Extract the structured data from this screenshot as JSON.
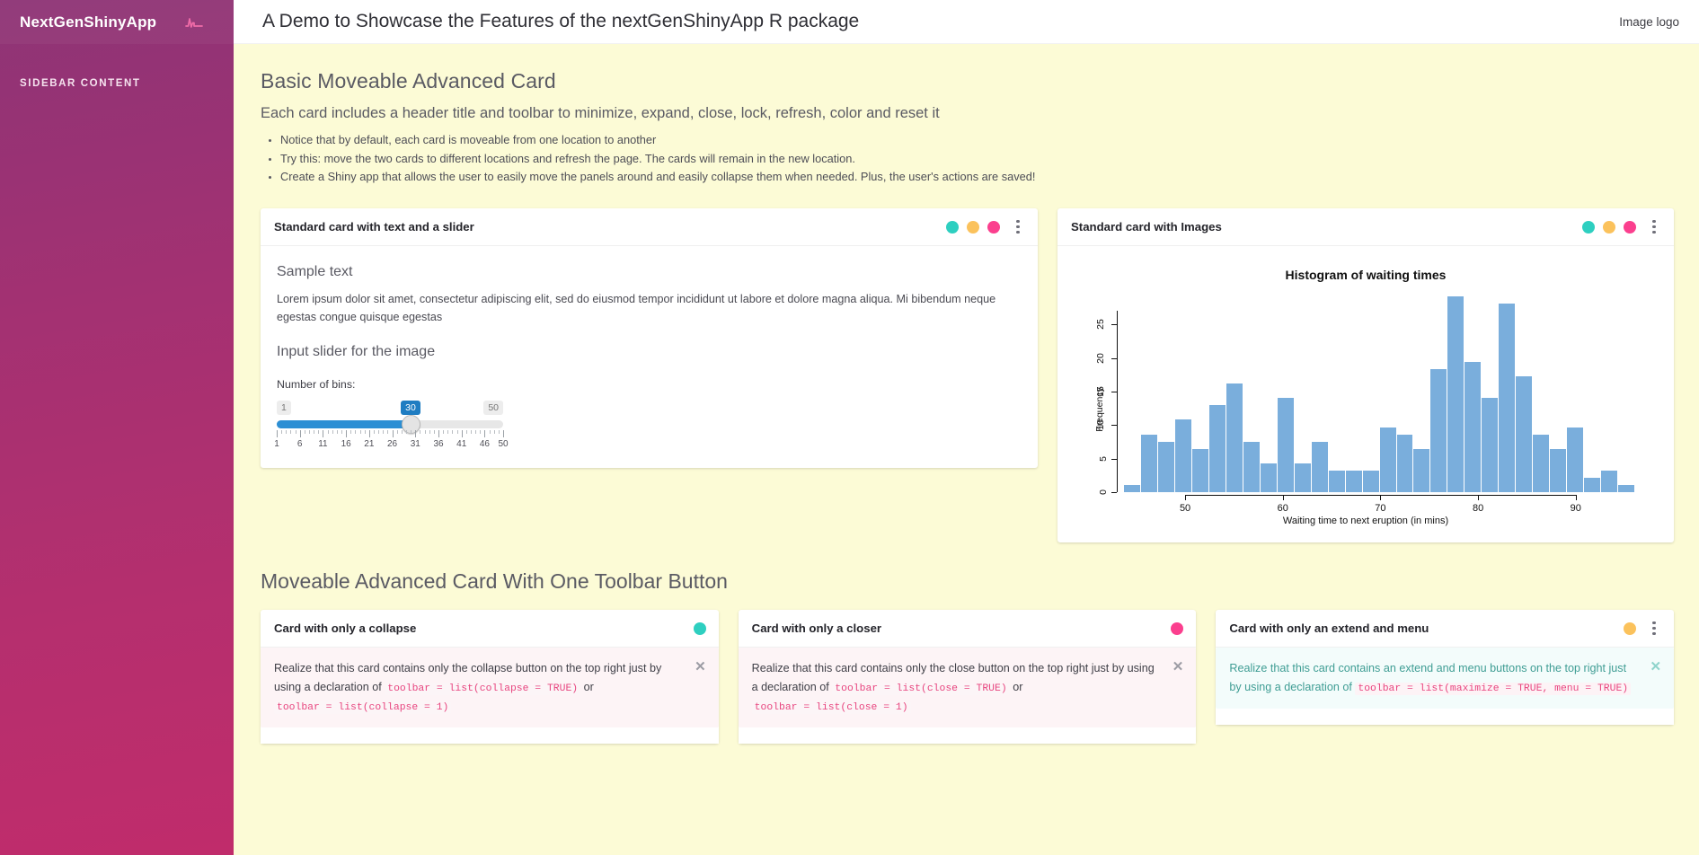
{
  "sidebar": {
    "brand": "NextGenShinyApp",
    "logo_icon": "pulse-waveform-icon",
    "heading": "SIDEBAR CONTENT",
    "gradient_from": "#8e3476",
    "gradient_to": "#c02c6b"
  },
  "topbar": {
    "title": "A Demo to Showcase the Features of the nextGenShinyApp R package",
    "right_label": "Image logo"
  },
  "section1": {
    "title": "Basic Moveable Advanced Card",
    "subtitle": "Each card includes a header title and toolbar to minimize, expand, close, lock, refresh, color and reset it",
    "bullets": [
      "Notice that by default, each card is moveable from one location to another",
      "Try this: move the two cards to different locations and refresh the page. The cards will remain in the new location.",
      "Create a Shiny app that allows the user to easily move the panels around and easily collapse them when needed. Plus, the user's actions are saved!"
    ]
  },
  "card_slider": {
    "title": "Standard card with text and a slider",
    "tools": {
      "dots": [
        {
          "name": "collapse-dot",
          "color": "#2ecfc0"
        },
        {
          "name": "maximize-dot",
          "color": "#fbc25c"
        },
        {
          "name": "close-dot",
          "color": "#fb3f8e"
        }
      ],
      "menu_icon": "kebab-menu-icon"
    },
    "sample_heading": "Sample text",
    "sample_text": "Lorem ipsum dolor sit amet, consectetur adipiscing elit, sed do eiusmod tempor incididunt ut labore et dolore magna aliqua. Mi bibendum neque egestas congue quisque egestas",
    "slider_heading": "Input slider for the image",
    "slider": {
      "label": "Number of bins:",
      "min": 1,
      "max": 50,
      "value": 30,
      "min_label": "1",
      "max_label": "50",
      "value_label": "30",
      "tick_labels": [
        "1",
        "6",
        "11",
        "16",
        "21",
        "26",
        "31",
        "36",
        "41",
        "46",
        "50"
      ],
      "tick_values": [
        1,
        6,
        11,
        16,
        21,
        26,
        31,
        36,
        41,
        46,
        50
      ],
      "fill_color": "#2c8fd4"
    }
  },
  "card_images": {
    "title": "Standard card with Images",
    "tools": {
      "dots": [
        {
          "name": "collapse-dot",
          "color": "#2ecfc0"
        },
        {
          "name": "maximize-dot",
          "color": "#fbc25c"
        },
        {
          "name": "close-dot",
          "color": "#fb3f8e"
        }
      ],
      "menu_icon": "kebab-menu-icon"
    }
  },
  "chart_data": {
    "type": "bar",
    "title": "Histogram of waiting times",
    "xlabel": "Waiting time to next eruption (in mins)",
    "ylabel": "Frequency",
    "bar_color": "#7aaedc",
    "grid": false,
    "legend": "none",
    "ylim": [
      0,
      27
    ],
    "xlim": [
      43,
      96
    ],
    "ytick_labels": [
      "0",
      "5",
      "10",
      "15",
      "20",
      "25"
    ],
    "ytick_values": [
      0,
      5,
      10,
      15,
      20,
      25
    ],
    "xtick_labels": [
      "50",
      "60",
      "70",
      "80",
      "90"
    ],
    "xtick_values": [
      50,
      60,
      70,
      80,
      90
    ],
    "bin_count": 30,
    "bin_edges": [
      43.0,
      44.7,
      46.5,
      48.2,
      49.9,
      51.6,
      53.4,
      55.1,
      56.8,
      58.5,
      60.3,
      62.0,
      63.7,
      65.4,
      67.2,
      68.9,
      70.6,
      72.3,
      74.1,
      75.8,
      77.5,
      79.2,
      81.0,
      82.7,
      84.4,
      86.1,
      87.9,
      89.6,
      91.3,
      93.0,
      94.7
    ],
    "categories": [
      "43-45",
      "45-46",
      "46-48",
      "48-50",
      "50-52",
      "52-53",
      "53-55",
      "55-57",
      "57-59",
      "59-60",
      "60-62",
      "62-64",
      "64-65",
      "65-67",
      "67-69",
      "69-71",
      "71-72",
      "72-74",
      "74-76",
      "76-77",
      "77-79",
      "79-81",
      "81-83",
      "83-84",
      "84-86",
      "86-88",
      "88-90",
      "90-91",
      "91-93",
      "93-95"
    ],
    "values": [
      1,
      8,
      7,
      10,
      6,
      12,
      15,
      7,
      4,
      13,
      4,
      7,
      3,
      3,
      3,
      9,
      8,
      6,
      17,
      27,
      18,
      13,
      26,
      16,
      8,
      6,
      9,
      2,
      3,
      1
    ]
  },
  "section2": {
    "title": "Moveable Advanced Card With One Toolbar Button"
  },
  "cards_row2": [
    {
      "title": "Card with only a collapse",
      "dots": [
        {
          "name": "collapse-dot",
          "color": "#2ecfc0"
        }
      ],
      "menu": false,
      "alert_style": "pink",
      "text_parts": [
        {
          "type": "text",
          "value": "Realize that this card contains only the collapse button on the top right just by using a declaration of "
        },
        {
          "type": "code",
          "value": "toolbar = list(collapse = TRUE)"
        },
        {
          "type": "text",
          "value": " or "
        },
        {
          "type": "code",
          "value": "toolbar = list(collapse = 1)"
        }
      ],
      "close_icon": "close-x-icon"
    },
    {
      "title": "Card with only a closer",
      "dots": [
        {
          "name": "close-dot",
          "color": "#fb3f8e"
        }
      ],
      "menu": false,
      "alert_style": "pink",
      "text_parts": [
        {
          "type": "text",
          "value": "Realize that this card contains only the close button on the top right just by using a declaration of "
        },
        {
          "type": "code",
          "value": "toolbar = list(close = TRUE)"
        },
        {
          "type": "text",
          "value": " or "
        },
        {
          "type": "code",
          "value": "toolbar = list(close = 1)"
        }
      ],
      "close_icon": "close-x-icon"
    },
    {
      "title": "Card with only an extend and menu",
      "dots": [
        {
          "name": "maximize-dot",
          "color": "#fbc25c"
        }
      ],
      "menu": true,
      "menu_icon": "kebab-menu-icon",
      "alert_style": "teal",
      "text_parts": [
        {
          "type": "text",
          "value": "Realize that this card contains an extend and menu buttons on the top right just by using a declaration of "
        },
        {
          "type": "code",
          "value": "toolbar = list(maximize = TRUE, menu = TRUE)"
        }
      ],
      "close_icon": "close-x-icon"
    }
  ]
}
